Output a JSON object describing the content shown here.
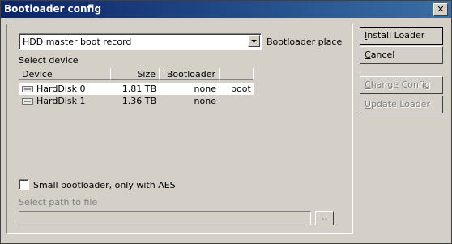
{
  "window": {
    "title": "Bootloader config"
  },
  "dropdown": {
    "value": "HDD master boot record"
  },
  "labels": {
    "bootloader_place": "Bootloader place",
    "select_device": "Select device",
    "small_bootloader": "Small bootloader, only with AES",
    "select_path": "Select path to file"
  },
  "table": {
    "headers": [
      "Device",
      "Size",
      "Bootloader",
      ""
    ],
    "rows": [
      {
        "device": "HardDisk 0",
        "size": "1.81 TB",
        "bootloader": "none",
        "extra": "boot"
      },
      {
        "device": "HardDisk 1",
        "size": "1.36 TB",
        "bootloader": "none",
        "extra": ""
      }
    ]
  },
  "path": {
    "value": "",
    "browse_label": ".."
  },
  "buttons": {
    "install": {
      "prefix": "",
      "underline": "I",
      "rest": "nstall Loader"
    },
    "cancel": {
      "prefix": "",
      "underline": "C",
      "rest": "ancel"
    },
    "change": {
      "prefix": "",
      "underline": "C",
      "rest": "hange Config"
    },
    "update": {
      "prefix": "",
      "underline": "U",
      "rest": "pdate Loader"
    }
  }
}
